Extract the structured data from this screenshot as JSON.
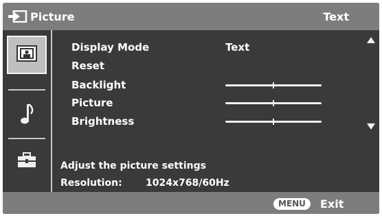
{
  "header": {
    "title": "Picture",
    "mode": "Text"
  },
  "sidebar": {
    "items": [
      {
        "icon": "picture-icon",
        "selected": true
      },
      {
        "icon": "music-note-icon",
        "selected": false
      },
      {
        "icon": "toolbox-icon",
        "selected": false
      }
    ]
  },
  "menu": {
    "display_mode": {
      "label": "Display Mode",
      "value": "Text"
    },
    "reset": {
      "label": "Reset"
    },
    "backlight": {
      "label": "Backlight",
      "level": 0.5
    },
    "picture": {
      "label": "Picture",
      "level": 0.5
    },
    "brightness": {
      "label": "Brightness",
      "level": 0.5
    }
  },
  "info": {
    "description": "Adjust the picture settings",
    "resolution_label": "Resolution:",
    "resolution_value": "1024x768/60Hz"
  },
  "footer": {
    "menu_button": "MENU",
    "exit_label": "Exit"
  },
  "colors": {
    "header_bg": "#7d7d7d",
    "panel_bg": "#3a3a3a",
    "text": "#ffffff"
  }
}
